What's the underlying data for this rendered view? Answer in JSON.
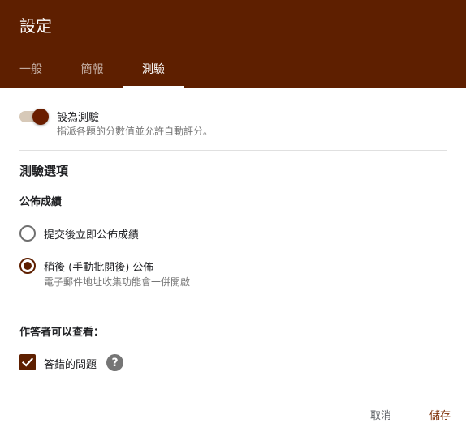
{
  "dialog": {
    "title": "設定"
  },
  "tabs": [
    {
      "label": "一般",
      "active": false
    },
    {
      "label": "簡報",
      "active": false
    },
    {
      "label": "測驗",
      "active": true
    }
  ],
  "quiz_toggle": {
    "label": "設為測驗",
    "description": "指派各題的分數值並允許自動評分。",
    "on": true
  },
  "quiz_options": {
    "title": "測驗選項",
    "release_grade": {
      "title": "公佈成績",
      "options": [
        {
          "label": "提交後立即公佈成績",
          "description": "",
          "selected": false
        },
        {
          "label": "稍後 (手動批閱後) 公佈",
          "description": "電子郵件地址收集功能會一併開啟",
          "selected": true
        }
      ]
    },
    "respondents_can_see": {
      "title": "作答者可以查看：",
      "items": [
        {
          "label": "答錯的問題",
          "checked": true
        }
      ]
    }
  },
  "footer": {
    "cancel_label": "取消",
    "save_label": "儲存"
  },
  "colors": {
    "header_bg": "#5e1f00",
    "accent": "#5e1f00",
    "toggle_track": "#d7c9b8"
  },
  "icons": {
    "help": "question-circle-icon",
    "check": "checkmark-icon"
  }
}
